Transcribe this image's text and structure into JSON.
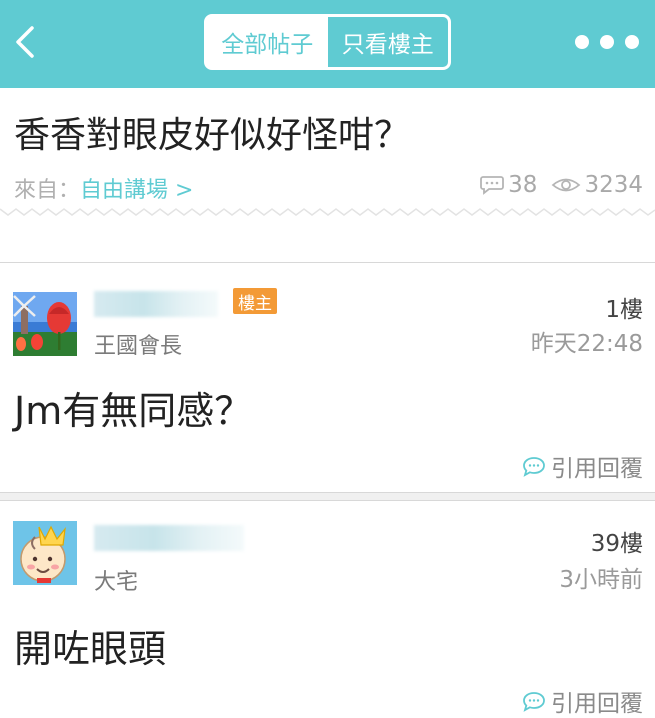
{
  "header": {
    "back_icon": "chevron-left-icon",
    "tabs": [
      {
        "label": "全部帖子",
        "active": false
      },
      {
        "label": "只看樓主",
        "active": true
      }
    ],
    "more_icon": "more-dots-icon",
    "accent_color": "#5fcbd2"
  },
  "thread": {
    "title": "香香對眼皮好似好怪咁？",
    "from_label": "來自：",
    "forum_link": "自由講場 >",
    "comment_count": "38",
    "view_count": "3234"
  },
  "posts": [
    {
      "rank": "王國會長",
      "op_badge": "樓主",
      "floor": "1樓",
      "time": "昨天22:48",
      "content": "Jm有無同感？",
      "reply_label": "引用回覆"
    },
    {
      "rank": "大宅",
      "floor": "39樓",
      "time": "3小時前",
      "content": "開咗眼頭",
      "reply_label": "引用回覆"
    }
  ]
}
